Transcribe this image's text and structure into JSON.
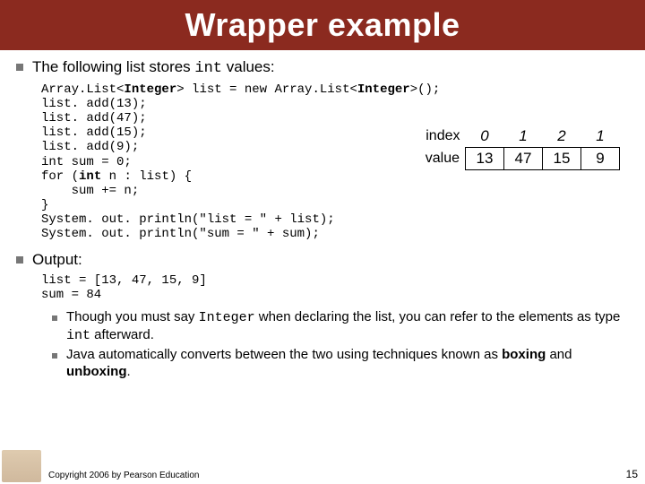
{
  "title": "Wrapper example",
  "bullet1_prefix": "The following list stores ",
  "bullet1_mono": "int",
  "bullet1_suffix": " values:",
  "code": {
    "l1a": "Array.List<",
    "l1b": "Integer",
    "l1c": "> list = new Array.List<",
    "l1d": "Integer",
    "l1e": ">();",
    "l2": "list. add(13);",
    "l3": "list. add(47);",
    "l4": "list. add(15);",
    "l5": "list. add(9);",
    "l6": "int sum = 0;",
    "l7a": "for (",
    "l7b": "int",
    "l7c": " n : list) {",
    "l8": "    sum += n;",
    "l9": "}",
    "l10": "System. out. println(\"list = \" + list);",
    "l11": "System. out. println(\"sum = \" + sum);"
  },
  "table": {
    "row1_label": "index",
    "row2_label": "value",
    "headers": [
      "0",
      "1",
      "2",
      "1"
    ],
    "values": [
      "13",
      "47",
      "15",
      "9"
    ]
  },
  "bullet2": "Output:",
  "output": {
    "l1": "list = [13, 47, 15, 9]",
    "l2": "sum = 84"
  },
  "sub1_a": "Though you must say ",
  "sub1_mono": "Integer",
  "sub1_b": " when declaring the list, you can refer to the elements as type ",
  "sub1_mono2": "int",
  "sub1_c": " afterward.",
  "sub2_a": "Java automatically converts between the two using techniques known as ",
  "sub2_b1": "boxing",
  "sub2_mid": " and ",
  "sub2_b2": "unboxing",
  "sub2_end": ".",
  "footer": "Copyright 2006 by Pearson Education",
  "page": "15"
}
